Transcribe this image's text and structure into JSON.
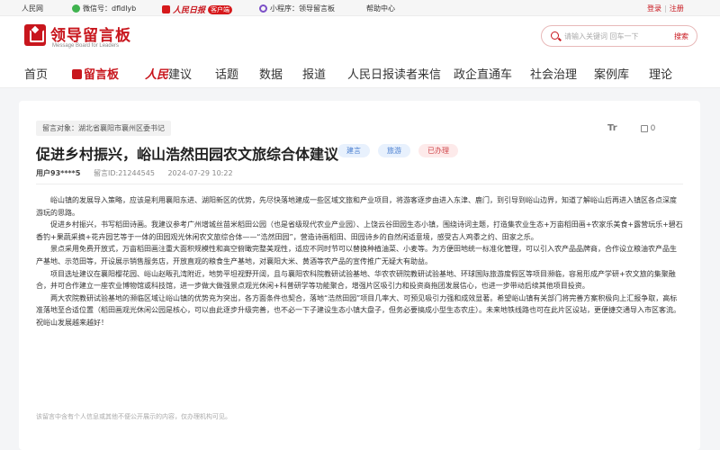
{
  "topbar": {
    "site": "人民网",
    "wechat": "微信号：dfldlyb",
    "pd_logo": "人民日报",
    "pd_badge": "客户端",
    "mini_program": "小程序：领导留言板",
    "help": "帮助中心",
    "login": "登录",
    "register": "注册"
  },
  "header": {
    "logo_title": "领导留言板",
    "logo_subtitle": "Message Board for Leaders",
    "search_placeholder": "请输入关键词 回车一下",
    "search_button": "搜索"
  },
  "nav": {
    "items": [
      "首页",
      "留言板",
      "建议",
      "话题",
      "数据",
      "报道",
      "人民日报读者来信",
      "政企直通车",
      "社会治理",
      "案例库",
      "理论"
    ],
    "rm_prefix": "人民"
  },
  "post": {
    "target": "留言对象：湖北省襄阳市襄州区委书记",
    "font_tool": "Tr",
    "likes": "0",
    "title": "促进乡村振兴，峪山浩然田园农文旅综合体建议",
    "tags": [
      "建言",
      "旅游",
      "已办理"
    ],
    "user": "用户93****5",
    "id": "留言ID:21244545",
    "date": "2024-07-29 10:22",
    "paragraphs": [
      "峪山镇的发展导入策略，应该是利用襄阳东进、湖阳新区的优势，先尽快落地建成一些区域文旅和产业项目，将游客逐步由进入东津、鹿门，到引导到峪山边界，知道了解峪山后再进入镇区各点深度游玩的思路。",
      "促进乡村振兴，书写稻田诗画。我建议参考广州增城丝苗米稻田公园（也是省级现代农业产业园）、上饶云谷田园生态小镇，围绕诗词主题，打造集农业生态+万亩稻田画+农家乐美食+露营玩乐+碧石香钓+果蔬采摘+花卉园艺等于一体的田园观光休闲农文旅综合体——“浩然田园”，营造诗画稻田、田园诗乡的自然闲适意境，感受古人鸡黍之约、田家之乐。",
      "景点采用免费开放式，万亩稻田画注重大面积规模性和高空俯瞰完整美观性，适应不同时节可以替换种植油菜、小麦等。为方便田地统一标准化管理，可以引入农产品品牌商，合作设立粮油农产品生产基地、示范田等，开设展示销售服务店，开放直观的粮食生产基地，对襄阳大米、黄酒等农产品的宣传推广无疑大有助益。",
      "项目选址建议在襄阳樱花园、峪山赵畈孔湾附近，地势平坦视野开阔，且与襄阳农科院教研试验基地、华农农研院教研试验基地、环球国际旅游度假区等项目濒临，容易形成产学研+农文旅的集聚融合，并可合作建立一座农业博物馆或科技馆，进一步做大做强景点观光休闲+科普研学等功能聚合，增强片区吸引力和投资商拖团发展信心，也进一步带动后续其他项目投资。",
      "两大农院教研试验基地的濒临区域让峪山镇的优势充为突出，各方面条件也契合，落地“浩然田园”项目几率大、可预见吸引力强和成效显著。希望峪山镇有关部门将完善方案积极向上汇报争取，高标准落地至合适位置（稻田画观光休闲公园是核心，可以由此逐步升级完善，也不必一下子建设生态小镇大盘子，但务必要搞成小型生态农庄）。未来地铁线路也可在此片区设站，更便捷交通导入市区客流。祝峪山发展越来越好！"
    ],
    "footnote": "该留言中含有个人信息或其他不便公开展示的内容，仅办理机构可见。"
  }
}
